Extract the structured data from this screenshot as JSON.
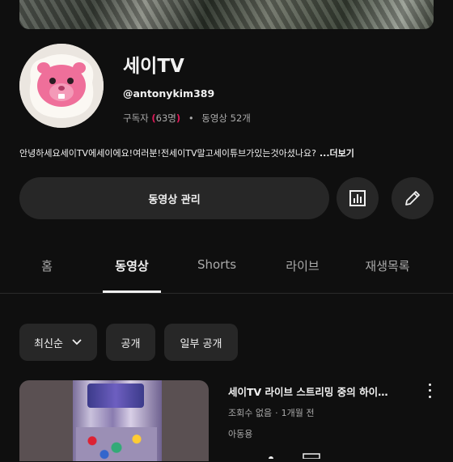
{
  "channel": {
    "name": "세이TV",
    "handle": "@antonykim389",
    "subscribers_label": "구독자",
    "subscribers_count": "63명",
    "videos": "동영상 52개",
    "description": "안녕하세요세이TV에세이에요!여러분!전세이TV말고세이튜브가있는것아셨나요?",
    "more": "...더보기"
  },
  "actions": {
    "manage_videos": "동영상 관리",
    "analytics_icon": "bar-chart-icon",
    "edit_icon": "pencil-icon"
  },
  "tabs": [
    {
      "label": "홈"
    },
    {
      "label": "동영상"
    },
    {
      "label": "Shorts"
    },
    {
      "label": "라이브"
    },
    {
      "label": "재생목록"
    }
  ],
  "active_tab": "동영상",
  "filters": {
    "sort": "최신순",
    "public": "공개",
    "partial_public": "일부 공개"
  },
  "videos": [
    {
      "title": "세이TV 라이브 스트리밍 중의 하이",
      "views": "조회수 없음",
      "age": "1개월 전",
      "tag": "아동용"
    }
  ],
  "colors": {
    "background": "#0f0f0f",
    "surface": "#272727",
    "annotation": "#e0195a",
    "avatar_character": "#ef6f9a"
  }
}
